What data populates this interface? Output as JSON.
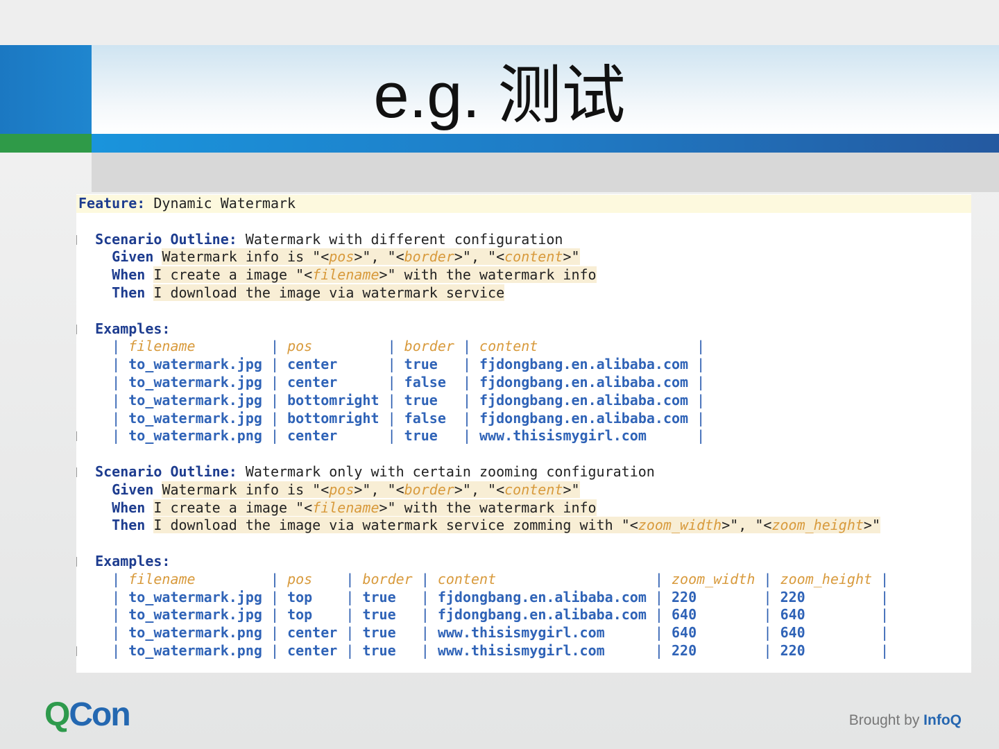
{
  "slide": {
    "title": "e.g. 测试"
  },
  "footer": {
    "logo_q": "Q",
    "logo_con": "Con",
    "brought": "Brought by ",
    "infoq": "InfoQ"
  },
  "code": {
    "feature": [
      {
        "c": "kw",
        "v": "Feature:"
      },
      {
        "c": "t",
        "v": " Dynamic Watermark"
      }
    ],
    "scenarios": [
      {
        "title": [
          {
            "c": "kw",
            "v": "Scenario Outline:"
          },
          {
            "c": "t",
            "v": " Watermark with different configuration"
          }
        ],
        "steps": [
          [
            {
              "c": "kw",
              "v": "Given"
            },
            {
              "c": "t",
              "v": " "
            },
            {
              "c": "h",
              "v": "Watermark info is \"<"
            },
            {
              "c": "hp",
              "v": "pos"
            },
            {
              "c": "h",
              "v": ">\", \"<"
            },
            {
              "c": "hp",
              "v": "border"
            },
            {
              "c": "h",
              "v": ">\", \"<"
            },
            {
              "c": "hp",
              "v": "content"
            },
            {
              "c": "h",
              "v": ">\""
            }
          ],
          [
            {
              "c": "kw",
              "v": "When"
            },
            {
              "c": "t",
              "v": " "
            },
            {
              "c": "h",
              "v": "I create a image \"<"
            },
            {
              "c": "hp",
              "v": "filename"
            },
            {
              "c": "h",
              "v": ">\" with the watermark info"
            }
          ],
          [
            {
              "c": "kw",
              "v": "Then"
            },
            {
              "c": "t",
              "v": " "
            },
            {
              "c": "h",
              "v": "I download the image via watermark service"
            }
          ]
        ],
        "examples_label": "Examples:",
        "headers": [
          "filename",
          "pos",
          "border",
          "content"
        ],
        "rows": [
          [
            "to_watermark.jpg",
            "center",
            "true",
            "fjdongbang.en.alibaba.com"
          ],
          [
            "to_watermark.jpg",
            "center",
            "false",
            "fjdongbang.en.alibaba.com"
          ],
          [
            "to_watermark.jpg",
            "bottomright",
            "true",
            "fjdongbang.en.alibaba.com"
          ],
          [
            "to_watermark.jpg",
            "bottomright",
            "false",
            "fjdongbang.en.alibaba.com"
          ],
          [
            "to_watermark.png",
            "center",
            "true",
            "www.thisismygirl.com"
          ]
        ]
      },
      {
        "title": [
          {
            "c": "kw",
            "v": "Scenario Outline:"
          },
          {
            "c": "t",
            "v": " Watermark only with certain zooming configuration"
          }
        ],
        "steps": [
          [
            {
              "c": "kw",
              "v": "Given"
            },
            {
              "c": "t",
              "v": " "
            },
            {
              "c": "h",
              "v": "Watermark info is \"<"
            },
            {
              "c": "hp",
              "v": "pos"
            },
            {
              "c": "h",
              "v": ">\", \"<"
            },
            {
              "c": "hp",
              "v": "border"
            },
            {
              "c": "h",
              "v": ">\", \"<"
            },
            {
              "c": "hp",
              "v": "content"
            },
            {
              "c": "h",
              "v": ">\""
            }
          ],
          [
            {
              "c": "kw",
              "v": "When"
            },
            {
              "c": "t",
              "v": " "
            },
            {
              "c": "h",
              "v": "I create a image \"<"
            },
            {
              "c": "hp",
              "v": "filename"
            },
            {
              "c": "h",
              "v": ">\" with the watermark info"
            }
          ],
          [
            {
              "c": "kw",
              "v": "Then"
            },
            {
              "c": "t",
              "v": " "
            },
            {
              "c": "h",
              "v": "I download the image via watermark service zomming with \"<"
            },
            {
              "c": "hp",
              "v": "zoom_width"
            },
            {
              "c": "h",
              "v": ">\", \"<"
            },
            {
              "c": "hp",
              "v": "zoom_height"
            },
            {
              "c": "h",
              "v": ">\""
            }
          ]
        ],
        "examples_label": "Examples:",
        "headers": [
          "filename",
          "pos",
          "border",
          "content",
          "zoom_width",
          "zoom_height"
        ],
        "rows": [
          [
            "to_watermark.jpg",
            "top",
            "true",
            "fjdongbang.en.alibaba.com",
            "220",
            "220"
          ],
          [
            "to_watermark.jpg",
            "top",
            "true",
            "fjdongbang.en.alibaba.com",
            "640",
            "640"
          ],
          [
            "to_watermark.png",
            "center",
            "true",
            "www.thisismygirl.com",
            "640",
            "640"
          ],
          [
            "to_watermark.png",
            "center",
            "true",
            "www.thisismygirl.com",
            "220",
            "220"
          ]
        ]
      }
    ]
  }
}
